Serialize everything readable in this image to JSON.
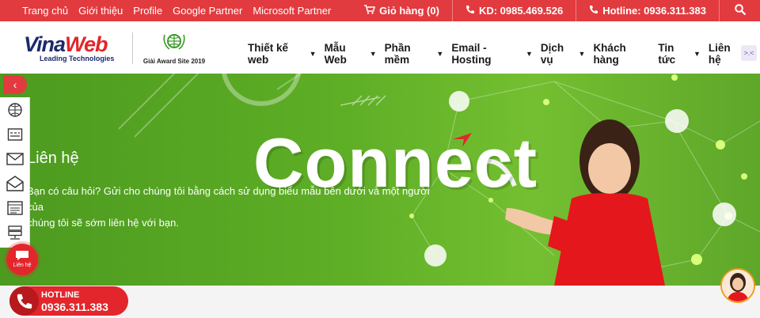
{
  "topbar": {
    "links": [
      "Trang chủ",
      "Giới thiệu",
      "Profile",
      "Google Partner",
      "Microsoft Partner"
    ],
    "cart_label": "Giỏ hàng (0)",
    "kd_label": "KD: 0985.469.526",
    "hotline_label": "Hotline: 0936.311.383"
  },
  "brand": {
    "name_part1": "Vina",
    "name_part2": "Web",
    "tagline": "Leading Technologies",
    "award_label": "Giải Award Site 2019"
  },
  "menu": [
    {
      "label": "Thiết kế web",
      "has_dropdown": true
    },
    {
      "label": "Mẫu Web",
      "has_dropdown": true
    },
    {
      "label": "Phần mềm",
      "has_dropdown": true
    },
    {
      "label": "Email - Hosting",
      "has_dropdown": true
    },
    {
      "label": "Dịch vụ",
      "has_dropdown": true
    },
    {
      "label": "Khách hàng",
      "has_dropdown": false
    },
    {
      "label": "Tin tức",
      "has_dropdown": true
    },
    {
      "label": "Liên hệ",
      "has_dropdown": true
    }
  ],
  "hero": {
    "title": "Liên hệ",
    "description_line1": "Bạn có câu hỏi? Gửi cho chúng tôi bằng cách sử dụng biểu mẫu bên dưới và một người của",
    "description_line2": "chúng tôi sẽ sớm liên hệ với bạn.",
    "banner_word": "Connect"
  },
  "floating": {
    "lienhe_label": "Liên hệ",
    "hotline_title": "HOTLINE",
    "hotline_number": "0936.311.383"
  },
  "colors": {
    "brand_red": "#e23b3f",
    "hero_green": "#5eae26",
    "navy": "#1b2a6b"
  }
}
